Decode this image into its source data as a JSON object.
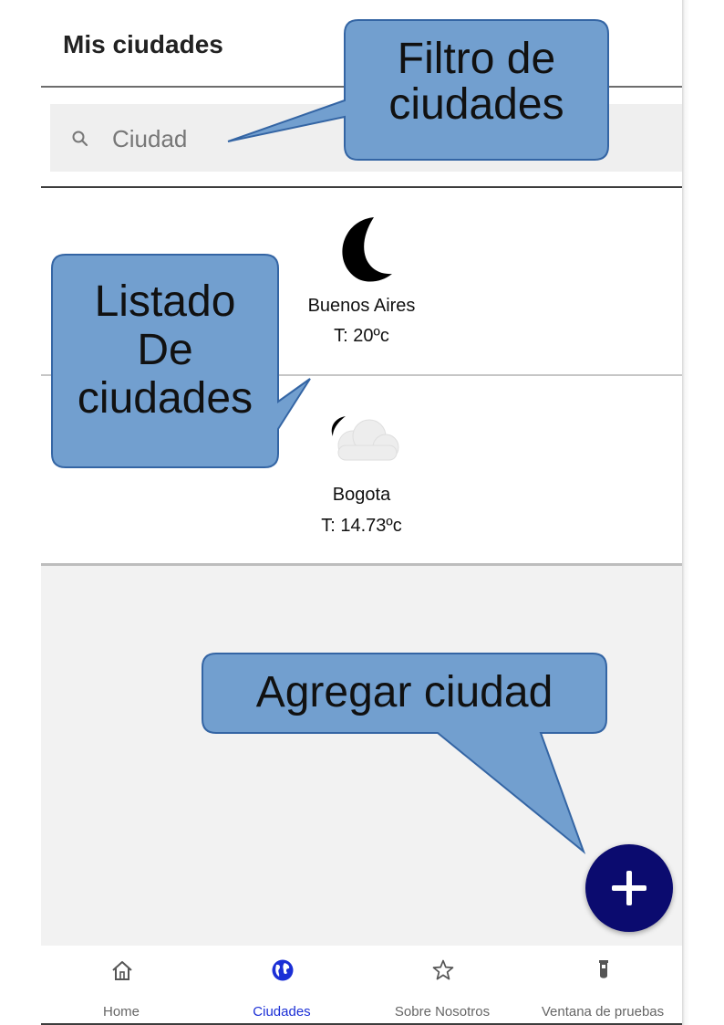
{
  "header": {
    "title": "Mis ciudades"
  },
  "search": {
    "placeholder": "Ciudad",
    "value": ""
  },
  "cities": [
    {
      "name": "Buenos Aires",
      "temp": "T: 20ºc",
      "icon": "moon-icon"
    },
    {
      "name": "Bogota",
      "temp": "T: 14.73ºc",
      "icon": "cloud-moon-icon"
    }
  ],
  "fab": {
    "icon": "plus-icon"
  },
  "nav": {
    "items": [
      {
        "label": "Home",
        "icon": "home-icon",
        "active": false
      },
      {
        "label": "Ciudades",
        "icon": "globe-icon",
        "active": true
      },
      {
        "label": "Sobre Nosotros",
        "icon": "star-icon",
        "active": false
      },
      {
        "label": "Ventana de pruebas",
        "icon": "flask-icon",
        "active": false
      }
    ]
  },
  "callouts": {
    "filter": {
      "line1": "Filtro de",
      "line2": "ciudades"
    },
    "list": {
      "line1": "Listado",
      "line2": "De",
      "line3": "ciudades"
    },
    "add": {
      "text": "Agregar ciudad"
    }
  },
  "colors": {
    "accent": "#1b2fd6",
    "fab": "#0b0b6f",
    "callout_fill": "#729fcf",
    "callout_stroke": "#3465a4"
  }
}
